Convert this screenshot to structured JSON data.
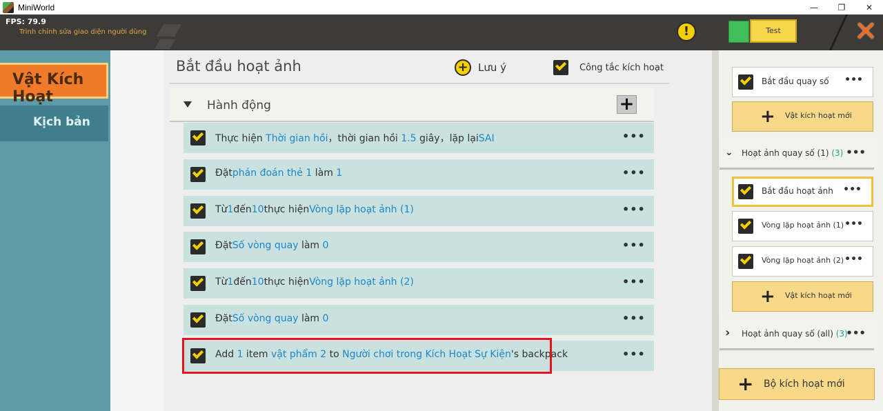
{
  "window": {
    "title": "MiniWorld",
    "minimize": "—",
    "maximize": "❐",
    "close": "✕"
  },
  "topbar": {
    "fps": "FPS: 79.9",
    "subtitle": "Trình chỉnh sửa giao diện người dùng",
    "warning_glyph": "!",
    "test_label": "Test",
    "close_glyph": "✕"
  },
  "left_tabs": {
    "active": "Vật Kích Hoạt",
    "second": "Kịch bản"
  },
  "main": {
    "title": "Bắt đầu hoạt ảnh",
    "note_glyph": "+",
    "note_label": "Lưu ý",
    "switch_label": "Công tắc kích hoạt",
    "section_label": "Hành động",
    "add_glyph": "+"
  },
  "actions": [
    {
      "parts": [
        [
          "Thực hiện ",
          false
        ],
        [
          "Thời gian hồi",
          true
        ],
        [
          "，thời gian hồi ",
          false
        ],
        [
          "1.5",
          true
        ],
        [
          " giây，lặp lại",
          false
        ],
        [
          "SAI",
          true
        ]
      ]
    },
    {
      "parts": [
        [
          "Đặt",
          false
        ],
        [
          "phán đoán thẻ 1",
          true
        ],
        [
          " làm ",
          false
        ],
        [
          "1",
          true
        ]
      ]
    },
    {
      "parts": [
        [
          "Từ",
          false
        ],
        [
          "1",
          true
        ],
        [
          "đến",
          false
        ],
        [
          "10",
          true
        ],
        [
          "thực hiện",
          false
        ],
        [
          "Vòng lặp hoạt ảnh (1)",
          true
        ]
      ]
    },
    {
      "parts": [
        [
          "Đặt",
          false
        ],
        [
          "Số vòng quay",
          true
        ],
        [
          " làm ",
          false
        ],
        [
          "0",
          true
        ]
      ]
    },
    {
      "parts": [
        [
          "Từ",
          false
        ],
        [
          "1",
          true
        ],
        [
          "đến",
          false
        ],
        [
          "10",
          true
        ],
        [
          "thực hiện",
          false
        ],
        [
          "Vòng lặp hoạt ảnh (2)",
          true
        ]
      ]
    },
    {
      "parts": [
        [
          "Đặt",
          false
        ],
        [
          "Số vòng quay",
          true
        ],
        [
          " làm ",
          false
        ],
        [
          "0",
          true
        ]
      ]
    },
    {
      "parts": [
        [
          "Add ",
          false
        ],
        [
          "1",
          true
        ],
        [
          " item ",
          false
        ],
        [
          "vật phẩm 2",
          true
        ],
        [
          " to ",
          false
        ],
        [
          "Người chơi trong Kích Hoạt Sự Kiện",
          true
        ],
        [
          "'s backpack",
          false
        ]
      ]
    }
  ],
  "action_menu": "•••",
  "right": {
    "item_start_spin": "Bắt đầu quay số",
    "new_trigger": "Vật kích hoạt mới",
    "group1_label": "Hoạt ảnh quay số (1)",
    "group1_count": "(3)",
    "item_start_anim": "Bắt đầu hoạt ảnh",
    "item_loop1": "Vòng lặp hoạt ảnh (1)",
    "item_loop2": "Vòng lặp hoạt ảnh (2)",
    "new_trigger2": "Vật kích hoạt mới",
    "group2_label": "Hoạt ảnh quay số (all)",
    "group2_count": "(3)",
    "new_set": "Bộ kích hoạt mới",
    "chev_down": "⌄",
    "chev_right": "›",
    "plus": "+"
  }
}
